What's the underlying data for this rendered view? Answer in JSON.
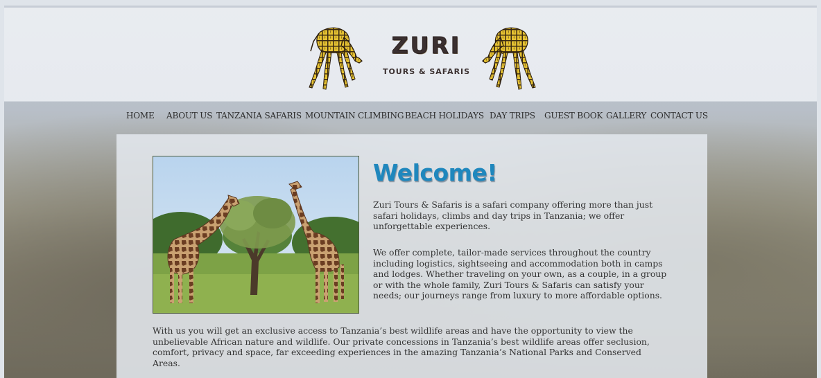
{
  "brand": {
    "name": "ZURI",
    "tagline": "TOURS & SAFARIS"
  },
  "nav": {
    "items": [
      {
        "label": "HOME"
      },
      {
        "label": "ABOUT US"
      },
      {
        "label": "TANZANIA SAFARIS"
      },
      {
        "label": "MOUNTAIN CLIMBING"
      },
      {
        "label": "BEACH HOLIDAYS"
      },
      {
        "label": "DAY TRIPS"
      },
      {
        "label": "GUEST BOOK"
      },
      {
        "label": "GALLERY"
      },
      {
        "label": "CONTACT US"
      }
    ]
  },
  "main": {
    "heading": "Welcome!",
    "paragraph1": "Zuri Tours & Safaris is a safari company offering more than just safari holidays, climbs and day trips in Tanzania; we offer unforgettable experiences.",
    "paragraph2": "We offer complete, tailor-made services throughout the country including logistics, sightseeing and accommodation both in camps and lodges. Whether traveling on your own, as a couple, in a group or with the whole family, Zuri Tours & Safaris can satisfy your needs; our journeys range from luxury to more affordable options.",
    "paragraph3": "With us you will get an exclusive access to Tanzania’s best wildlife areas and have the opportunity to view the unbelievable African nature and wildlife. Our private concessions in Tanzania’s best wildlife areas offer seclusion, comfort, privacy and space, far exceeding experiences in the amazing Tanzania’s National Parks and Conserved Areas."
  },
  "colors": {
    "heading": "#1f87bd",
    "nav_text": "#2d2d2d",
    "body_text": "#333333",
    "giraffe_fill": "#e6c232",
    "giraffe_pattern": "#3a2a12"
  }
}
